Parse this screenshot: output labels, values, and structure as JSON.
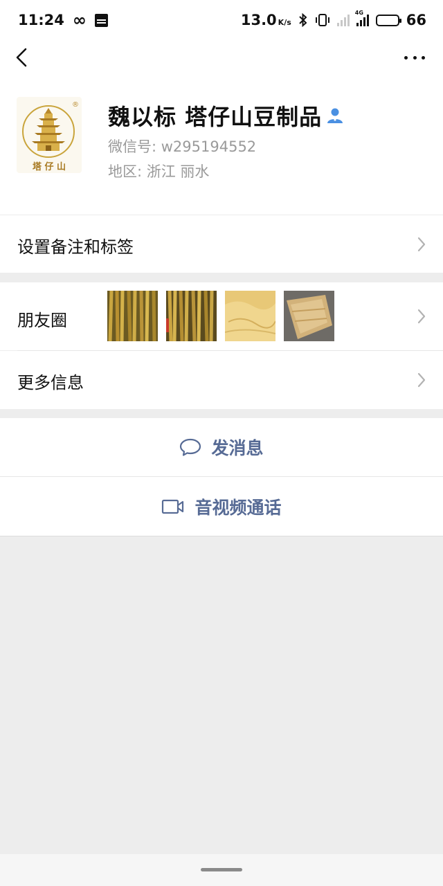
{
  "status_bar": {
    "time": "11:24",
    "speed": "13.0",
    "speed_unit": "K/s",
    "battery": "66",
    "network_label": "4G",
    "icons": [
      "infinity-icon",
      "news-icon",
      "bluetooth-icon",
      "vibrate-icon",
      "signal-icon",
      "battery-icon"
    ]
  },
  "nav": {
    "icons": [
      "back-icon",
      "more-icon"
    ]
  },
  "profile": {
    "name": "魏以标  塔仔山豆制品",
    "wechat_id": "微信号:  w295194552",
    "region": "地区:  浙江  丽水",
    "avatar_text": "塔 仔 山",
    "avatar_mark": "®"
  },
  "menu": {
    "remark_tags": "设置备注和标签",
    "moments": "朋友圈",
    "more_info": "更多信息"
  },
  "actions": {
    "send_message": "发消息",
    "av_call": "音视频通话"
  },
  "colors": {
    "link": "#576b95",
    "background": "#ededed",
    "verified": "#4a90e2"
  }
}
